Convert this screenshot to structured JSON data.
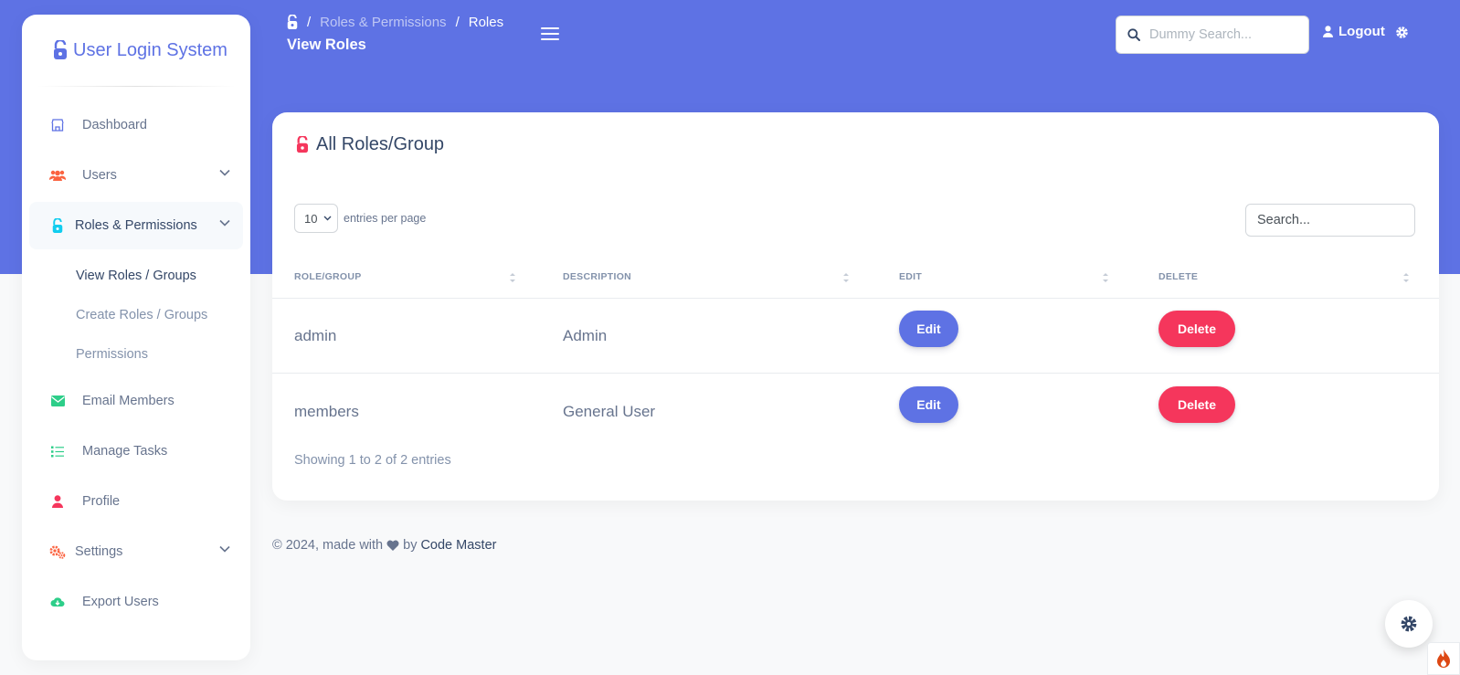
{
  "sidebar": {
    "brand": "User Login System",
    "items": [
      {
        "label": "Dashboard",
        "icon": "shop-icon",
        "color": "#5e72e4"
      },
      {
        "label": "Users",
        "icon": "users-icon",
        "color": "#fb6340"
      },
      {
        "label": "Roles & Permissions",
        "icon": "unlock-icon",
        "color": "#11cdef"
      },
      {
        "label": "Email Members",
        "icon": "envelope-icon",
        "color": "#2dce89"
      },
      {
        "label": "Manage Tasks",
        "icon": "list-icon",
        "color": "#2dce89"
      },
      {
        "label": "Profile",
        "icon": "user-icon",
        "color": "#f5365c"
      },
      {
        "label": "Settings",
        "icon": "cogs-icon",
        "color": "#fb6340"
      },
      {
        "label": "Export Users",
        "icon": "cloud-download-icon",
        "color": "#2dce89"
      }
    ],
    "submenu": [
      "View Roles / Groups",
      "Create Roles / Groups",
      "Permissions"
    ]
  },
  "header": {
    "breadcrumb_sep": "/",
    "breadcrumb_parent": "Roles & Permissions",
    "breadcrumb_current": "Roles",
    "page_title": "View Roles",
    "search_placeholder": "Dummy Search...",
    "logout_label": "Logout"
  },
  "card": {
    "title": "All Roles/Group",
    "page_size": "10",
    "entries_label": "entries per page",
    "search_placeholder": "Search...",
    "columns": [
      "ROLE/GROUP",
      "DESCRIPTION",
      "EDIT",
      "DELETE"
    ],
    "rows": [
      {
        "role": "admin",
        "description": "Admin",
        "edit": "Edit",
        "delete": "Delete"
      },
      {
        "role": "members",
        "description": "General User",
        "edit": "Edit",
        "delete": "Delete"
      }
    ],
    "showing": "Showing 1 to 2 of 2 entries"
  },
  "footer": {
    "prefix": "© 2024, made with",
    "by": "by",
    "author": "Code Master"
  },
  "colors": {
    "primary": "#5e72e4",
    "danger": "#f5365c",
    "heading": "#344767"
  }
}
